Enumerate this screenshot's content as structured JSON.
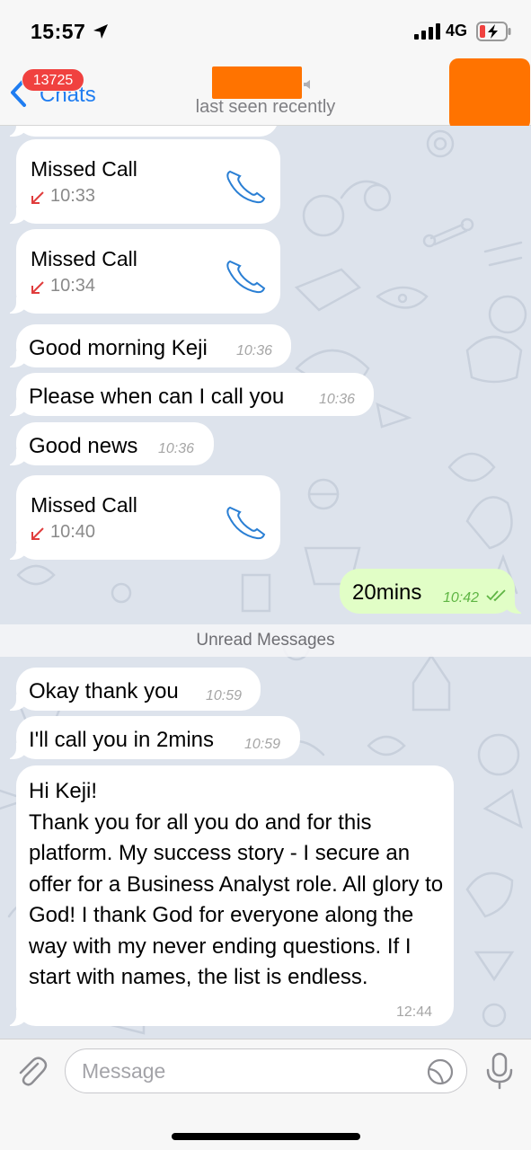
{
  "status_bar": {
    "time": "15:57",
    "network": "4G"
  },
  "header": {
    "back_label": "Chats",
    "unread_badge": "13725",
    "status": "last seen recently"
  },
  "messages": [
    {
      "type": "missed_call",
      "title": "Missed Call",
      "time": "10:33"
    },
    {
      "type": "missed_call",
      "title": "Missed Call",
      "time": "10:34"
    },
    {
      "type": "incoming",
      "text": "Good morning Keji",
      "time": "10:36"
    },
    {
      "type": "incoming",
      "text": "Please when can I call you",
      "time": "10:36"
    },
    {
      "type": "incoming",
      "text": "Good news",
      "time": "10:36"
    },
    {
      "type": "missed_call",
      "title": "Missed Call",
      "time": "10:40"
    },
    {
      "type": "outgoing",
      "text": "20mins",
      "time": "10:42",
      "read": true
    },
    {
      "type": "incoming",
      "text": "Okay thank you",
      "time": "10:59"
    },
    {
      "type": "incoming",
      "text": "I'll call you in 2mins",
      "time": "10:59"
    },
    {
      "type": "incoming",
      "text": "Hi Keji!\nThank you for all you do and for this platform. My success story - I secure an offer for a Business Analyst role. All glory to God! I thank God for everyone along the way with my never ending questions. If I start with names, the list is endless.",
      "time": "12:44"
    }
  ],
  "unread_divider": "Unread Messages",
  "input": {
    "placeholder": "Message"
  },
  "colors": {
    "accent": "#1f7df1",
    "badge": "#f0413f",
    "outgoing_bubble": "#e1fec6",
    "redaction": "#ff7300",
    "missed_call_arrow": "#e03c3c",
    "read_check": "#5fb544"
  },
  "icons": {
    "location": "location-arrow-icon",
    "signal": "signal-bars-icon",
    "battery": "battery-charging-icon",
    "back": "chevron-left-icon",
    "phone": "phone-icon",
    "missed": "missed-call-arrow-icon",
    "read": "double-check-icon",
    "attach": "paperclip-icon",
    "sticker": "sticker-icon",
    "mic": "microphone-icon"
  }
}
